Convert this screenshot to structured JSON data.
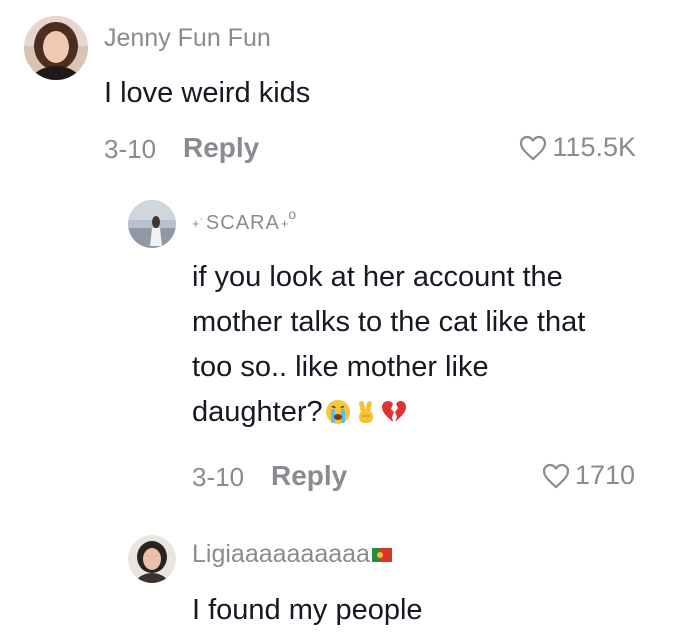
{
  "comments": [
    {
      "username": "Jenny Fun Fun",
      "text": "I love weird kids",
      "date": "3-10",
      "reply_label": "Reply",
      "likes": "115.5K"
    },
    {
      "username": "SCARA",
      "text_lines": [
        "if you look at her account the",
        "mother talks to the cat like that",
        "too so.. like mother like",
        "daughter?"
      ],
      "emojis": [
        "crying-face",
        "victory-hand",
        "broken-heart"
      ],
      "date": "3-10",
      "reply_label": "Reply",
      "likes": "1710"
    },
    {
      "username": "Ligiaaaaaaaaaa",
      "flag": "portugal-flag",
      "text": "I found my people"
    }
  ],
  "colors": {
    "text": "#161823",
    "muted": "#8a8b91"
  }
}
